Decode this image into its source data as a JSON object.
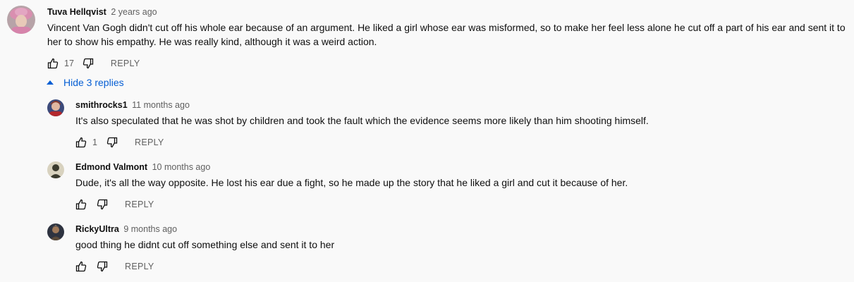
{
  "comments": [
    {
      "author": "Tuva Hellqvist",
      "time": "2 years ago",
      "text": "Vincent Van Gogh didn't cut off his whole ear because of an argument. He liked a girl whose ear was misformed, so to make her feel less alone he cut off a part of his ear and sent it to her to show his empathy. He was really kind, although it was a weird action.",
      "likes": "17",
      "reply_label": "REPLY",
      "avatar_icon": "avatar-woman-pink-hat"
    }
  ],
  "replies_toggle": {
    "label": "Hide 3 replies",
    "icon": "caret-up-icon",
    "color": "#065fd4"
  },
  "replies": [
    {
      "author": "smithrocks1",
      "time": "11 months ago",
      "text": "It's also speculated that he was shot by children and took the fault which the evidence seems more likely than him shooting himself.",
      "likes": "1",
      "reply_label": "REPLY",
      "avatar_icon": "avatar-character"
    },
    {
      "author": "Edmond Valmont",
      "time": "10 months ago",
      "text": "Dude, it's all the way opposite. He lost his ear due a fight, so he made up the story that he liked a girl and cut it because of her.",
      "likes": "",
      "reply_label": "REPLY",
      "avatar_icon": "avatar-silhouette"
    },
    {
      "author": "RickyUltra",
      "time": "9 months ago",
      "text": "good thing he didnt cut off something else and sent it to her",
      "likes": "",
      "reply_label": "REPLY",
      "avatar_icon": "avatar-dark-figure"
    }
  ],
  "colors": {
    "background": "#f9f9f9",
    "secondary_text": "#606060",
    "link_blue": "#065fd4"
  }
}
